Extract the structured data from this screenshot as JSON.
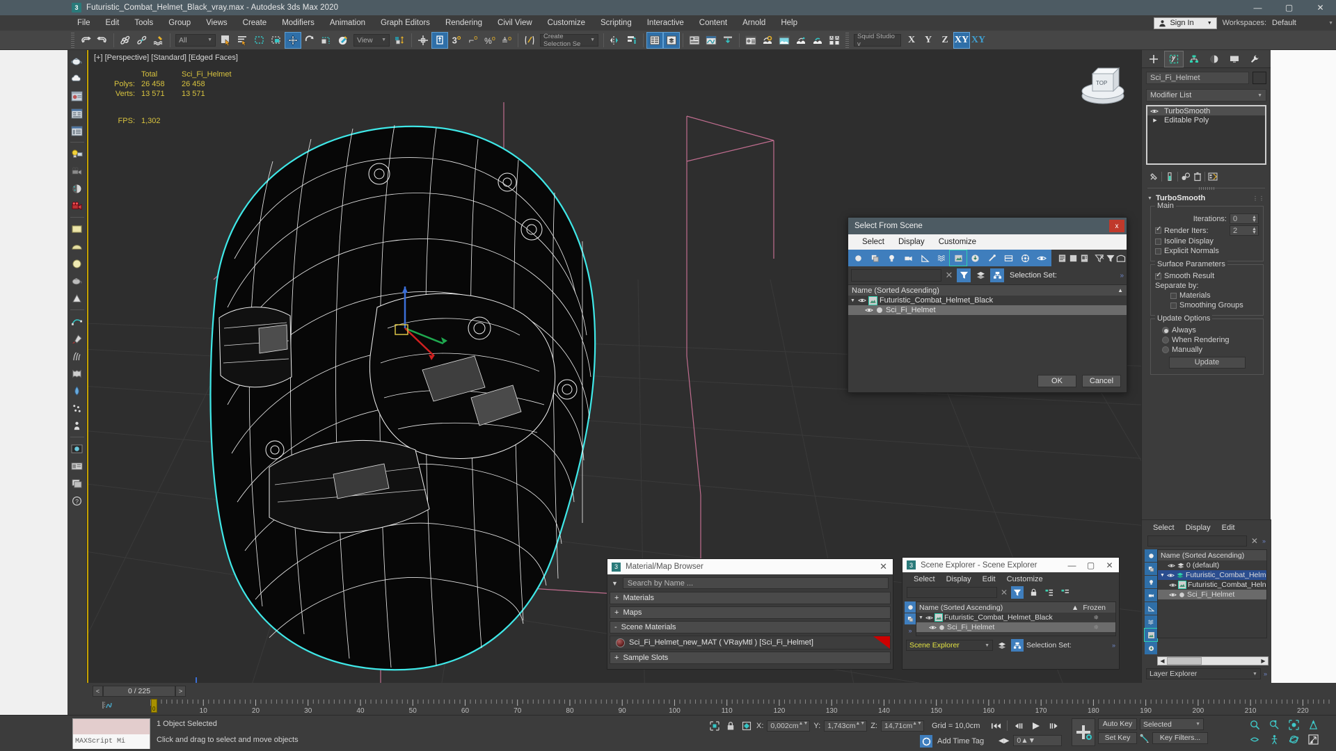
{
  "window": {
    "title": "Futuristic_Combat_Helmet_Black_vray.max - Autodesk 3ds Max 2020",
    "app_icon": "3",
    "minimize": "—",
    "maximize": "▢",
    "close": "✕"
  },
  "menubar": {
    "items": [
      "File",
      "Edit",
      "Tools",
      "Group",
      "Views",
      "Create",
      "Modifiers",
      "Animation",
      "Graph Editors",
      "Rendering",
      "Civil View",
      "Customize",
      "Scripting",
      "Interactive",
      "Content",
      "Arnold",
      "Help"
    ],
    "sign_in": "Sign In",
    "sign_in_icon": "person-icon",
    "workspaces_label": "Workspaces:",
    "workspace_value": "Default"
  },
  "toolbar": {
    "selection_filter": "All",
    "reference_coord": "View",
    "named_selection_set": "Create Selection Se",
    "render_preset": "Squid Studio v",
    "axis_buttons": [
      "X",
      "Y",
      "Z",
      "XY"
    ],
    "axis_active": "XY",
    "axis_extra": "XY"
  },
  "viewport": {
    "label": "[+] [Perspective] [Standard] [Edged Faces]",
    "stats": {
      "col_total": "Total",
      "col_object": "Sci_Fi_Helmet",
      "rows": [
        {
          "key": "Polys:",
          "total": "26 458",
          "object": "26 458"
        },
        {
          "key": "Verts:",
          "total": "13 571",
          "object": "13 571"
        }
      ],
      "fps_key": "FPS:",
      "fps_value": "1,302"
    }
  },
  "select_from_scene": {
    "title": "Select From Scene",
    "close": "x",
    "menu": [
      "Select",
      "Display",
      "Customize"
    ],
    "filter_placeholder": "",
    "selection_set_label": "Selection Set:",
    "column_header": "Name (Sorted Ascending)",
    "sort_arrow": "▲",
    "rows": [
      {
        "name": "Futuristic_Combat_Helmet_Black",
        "indent": 0,
        "selected": false
      },
      {
        "name": "Sci_Fi_Helmet",
        "indent": 1,
        "selected": true
      }
    ],
    "ok": "OK",
    "cancel": "Cancel"
  },
  "command_panel": {
    "object_name": "Sci_Fi_Helmet",
    "modifier_list": "Modifier List",
    "stack": [
      {
        "label": "TurboSmooth",
        "selected": true
      },
      {
        "label": "Editable Poly",
        "selected": false
      }
    ],
    "rollout_title": "TurboSmooth",
    "main_group": "Main",
    "iterations_label": "Iterations:",
    "iterations_value": "0",
    "render_iters_label": "Render Iters:",
    "render_iters_value": "2",
    "render_iters_checked": true,
    "isoline_label": "Isoline Display",
    "explicit_normals_label": "Explicit Normals",
    "surface_group": "Surface Parameters",
    "smooth_result_label": "Smooth Result",
    "separate_by_label": "Separate by:",
    "materials_label": "Materials",
    "smoothing_groups_label": "Smoothing Groups",
    "update_group": "Update Options",
    "update_options": [
      "Always",
      "When Rendering",
      "Manually"
    ],
    "update_selected": "Always",
    "update_button": "Update"
  },
  "cp_explorer": {
    "menu": [
      "Select",
      "Display",
      "Edit"
    ],
    "column_header": "Name (Sorted Ascending)",
    "rows": [
      {
        "name": "0 (default)",
        "indent": 1,
        "style": "none"
      },
      {
        "name": "Futuristic_Combat_Helmet_",
        "indent": 0,
        "style": "blue"
      },
      {
        "name": "Futuristic_Combat_Heln",
        "indent": 2,
        "style": "none"
      },
      {
        "name": "Sci_Fi_Helmet",
        "indent": 2,
        "style": "gray"
      }
    ],
    "combo_value": "Layer Explorer"
  },
  "material_browser": {
    "title": "Material/Map Browser",
    "icon": "3",
    "close": "✕",
    "search_placeholder": "Search by Name ...",
    "sections": [
      {
        "sign": "+",
        "label": "Materials"
      },
      {
        "sign": "+",
        "label": "Maps"
      },
      {
        "sign": "-",
        "label": "Scene Materials"
      }
    ],
    "material_entry": "Sci_Fi_Helmet_new_MAT  ( VRayMtl )  [Sci_Fi_Helmet]",
    "last_section": {
      "sign": "+",
      "label": "Sample Slots"
    }
  },
  "scene_explorer": {
    "title": "Scene Explorer - Scene Explorer",
    "icon": "3",
    "minimize": "—",
    "maximize": "▢",
    "close": "✕",
    "menu": [
      "Select",
      "Display",
      "Edit",
      "Customize"
    ],
    "column_name": "Name (Sorted Ascending)",
    "column_frozen": "Frozen",
    "sort_arrow": "▲",
    "rows": [
      {
        "name": "Futuristic_Combat_Helmet_Black",
        "indent": 0,
        "selected": false,
        "frozen": "❅"
      },
      {
        "name": "Sci_Fi_Helmet",
        "indent": 1,
        "selected": true,
        "frozen": "❅"
      }
    ],
    "combo_value": "Scene Explorer",
    "selection_set_label": "Selection Set:"
  },
  "timeline": {
    "prev": "<",
    "next": ">",
    "frame_readout": "0 / 225",
    "ticks": [
      0,
      10,
      20,
      30,
      40,
      50,
      60,
      70,
      80,
      90,
      100,
      110,
      120,
      130,
      140,
      150,
      160,
      170,
      180,
      190,
      200,
      210,
      220
    ],
    "slider_label": "0"
  },
  "status": {
    "maxscript_label": "MAXScript Mi",
    "selection_msg": "1 Object Selected",
    "hint_msg": "Click and drag to select and move objects",
    "x_label": "X:",
    "x_value": "0,002cm",
    "y_label": "Y:",
    "y_value": "1,743cm",
    "z_label": "Z:",
    "z_value": "14,71cm",
    "grid": "Grid = 10,0cm",
    "add_time_tag": "Add Time Tag",
    "frame_value": "0",
    "auto_key": "Auto Key",
    "set_key": "Set Key",
    "key_mode": "Selected",
    "key_filters": "Key Filters..."
  },
  "colors": {
    "accent_blue": "#2f6fa8",
    "title_bar": "#4d5b63",
    "panel_bg": "#3c3c3c",
    "viewport_bg": "#2e2e2e",
    "stat_yellow": "#d8c33f",
    "wireframe_cyan": "#33e0e0",
    "selection_blue": "#2a4d8f",
    "red_close": "#c0392b"
  }
}
